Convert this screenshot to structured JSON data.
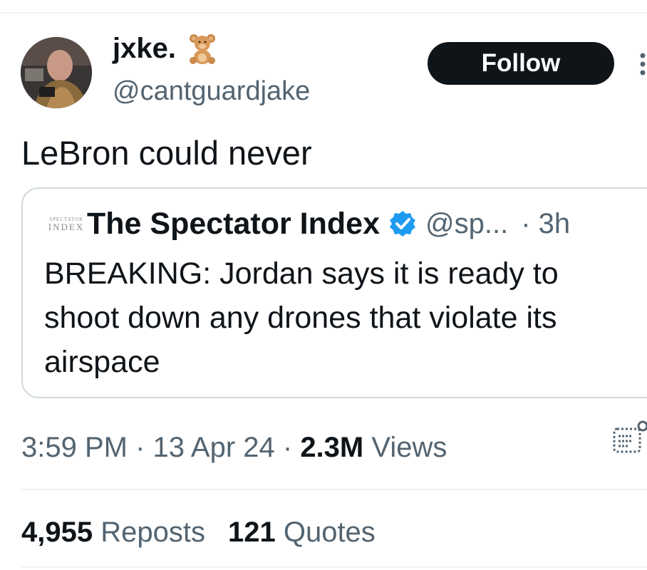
{
  "author": {
    "display_name": "jxke.",
    "handle": "@cantguardjake",
    "emoji_icon": "teddy-bear-icon"
  },
  "follow_label": "Follow",
  "tweet_text": "LeBron could never",
  "quote": {
    "logo_line1": "SPECTATOR",
    "logo_line2": "INDEX",
    "name": "The Spectator Index",
    "handle": "@sp...",
    "time": "· 3h",
    "text": "BREAKING: Jordan says it is ready to shoot down any drones that violate its airspace",
    "verified_color": "#1d9bf0"
  },
  "meta": {
    "time": "3:59 PM",
    "sep1": " · ",
    "date": "13 Apr 24",
    "sep2": " · ",
    "views_count": "2.3M",
    "views_label": " Views"
  },
  "engagement": {
    "reposts_count": "4,955",
    "reposts_label": " Reposts",
    "quotes_count": "121",
    "quotes_label": " Quotes"
  }
}
